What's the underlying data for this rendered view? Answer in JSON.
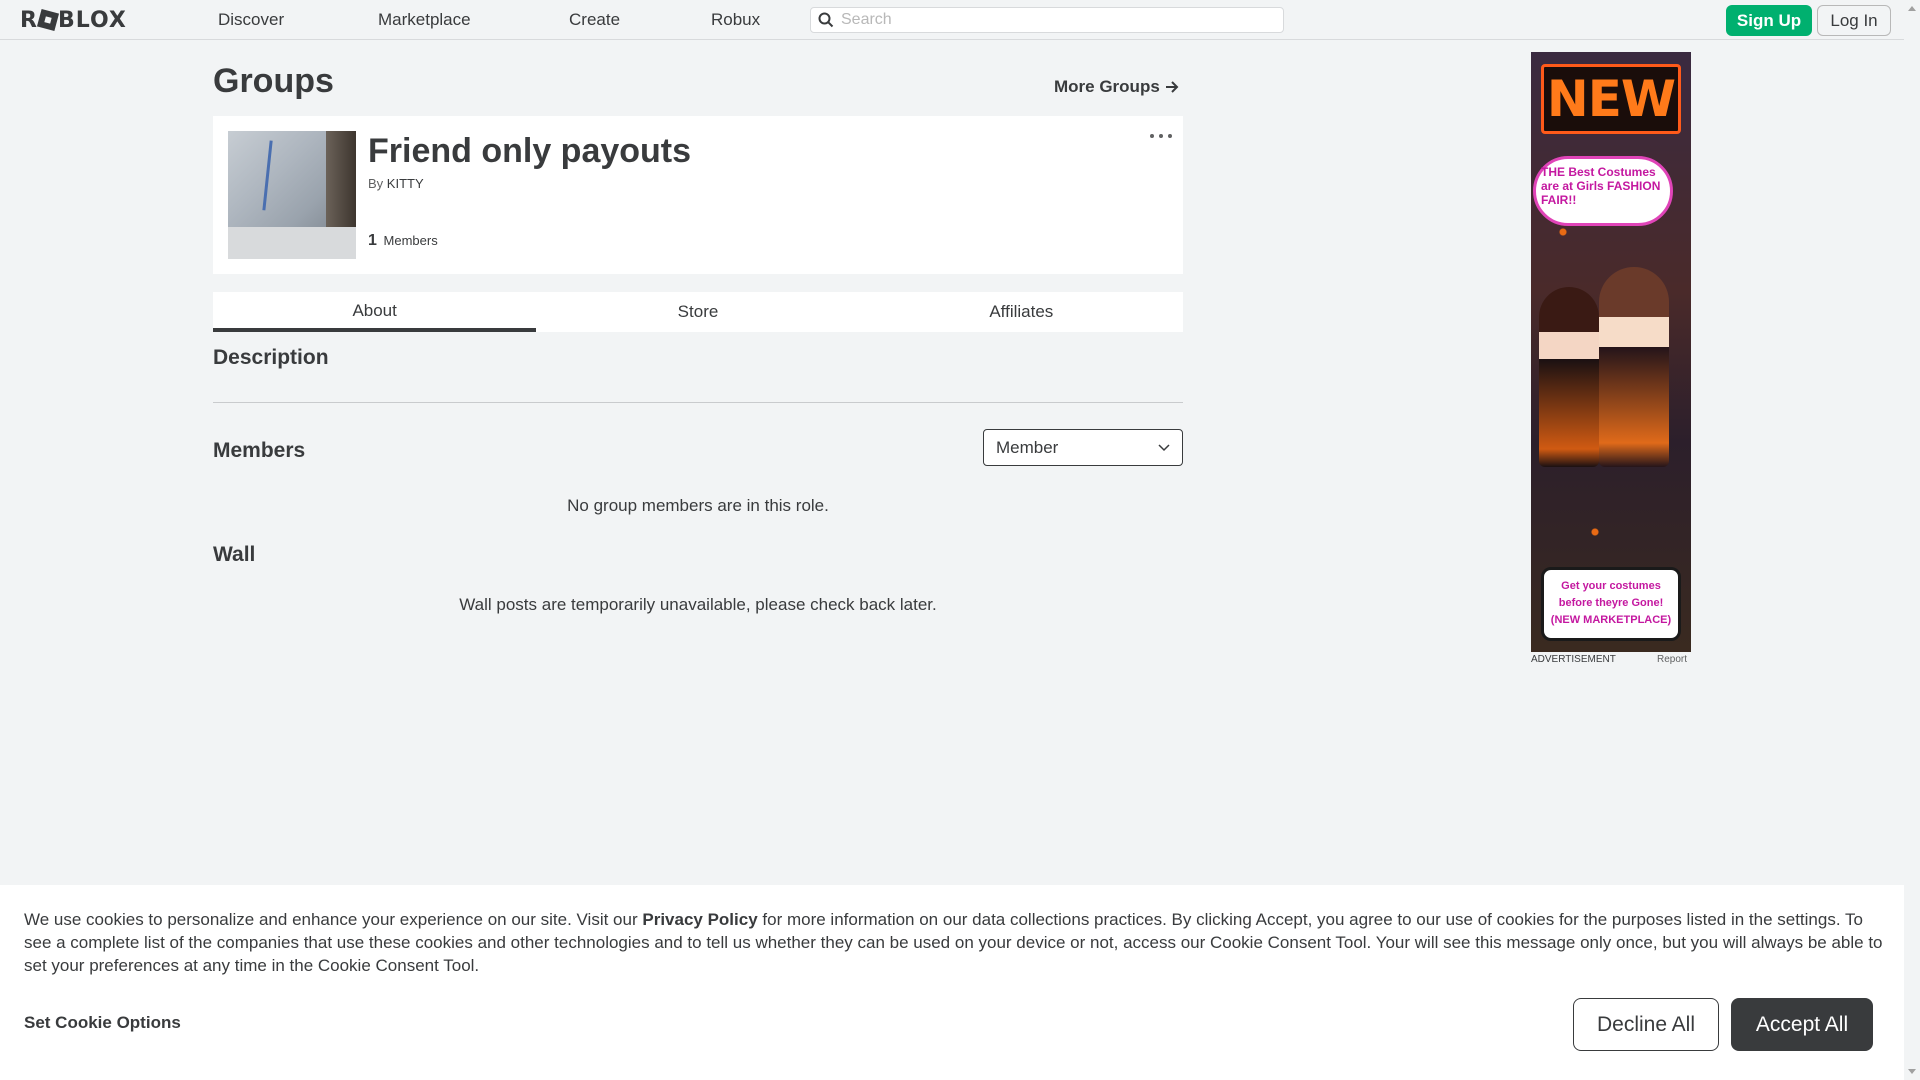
{
  "nav": {
    "logo": "ROBLOX",
    "links": [
      "Discover",
      "Marketplace",
      "Create",
      "Robux"
    ],
    "search_placeholder": "Search",
    "signup_label": "Sign Up",
    "login_label": "Log In"
  },
  "page": {
    "title": "Groups",
    "more_groups_label": "More Groups"
  },
  "group": {
    "name": "Friend only payouts",
    "by_prefix": "By",
    "owner": "KITTY",
    "member_count": "1",
    "members_label": "Members"
  },
  "tabs": [
    "About",
    "Store",
    "Affiliates"
  ],
  "sections": {
    "description_title": "Description",
    "members_title": "Members",
    "role_selected": "Member",
    "members_empty": "No group members are in this role.",
    "wall_title": "Wall",
    "wall_message": "Wall posts are temporarily unavailable, please check back later."
  },
  "ad": {
    "headline": "NEW",
    "bubble_text": "THE Best Costumes are at Girls FASHION FAIR!!",
    "cta_text": "Get your costumes before theyre Gone! (NEW MARKETPLACE)",
    "label": "ADVERTISEMENT",
    "report_label": "Report"
  },
  "cookie": {
    "text_before": "We use cookies to personalize and enhance your experience on our site. Visit our ",
    "privacy_link": "Privacy Policy",
    "text_after": " for more information on our data collections practices. By clicking Accept, you agree to our use of cookies for the purposes listed in the settings. To see a complete list of the companies that use these cookies and other technologies and to tell us whether they can be used on your device or not, access our Cookie Consent Tool. Your will see this message only once, but you will always be able to set your preferences at any time in the Cookie Consent Tool.",
    "options_label": "Set Cookie Options",
    "decline_label": "Decline All",
    "accept_label": "Accept All"
  },
  "colors": {
    "accent_green": "#00b06f",
    "text_primary": "#393b3d",
    "background": "#f2f4f5"
  }
}
